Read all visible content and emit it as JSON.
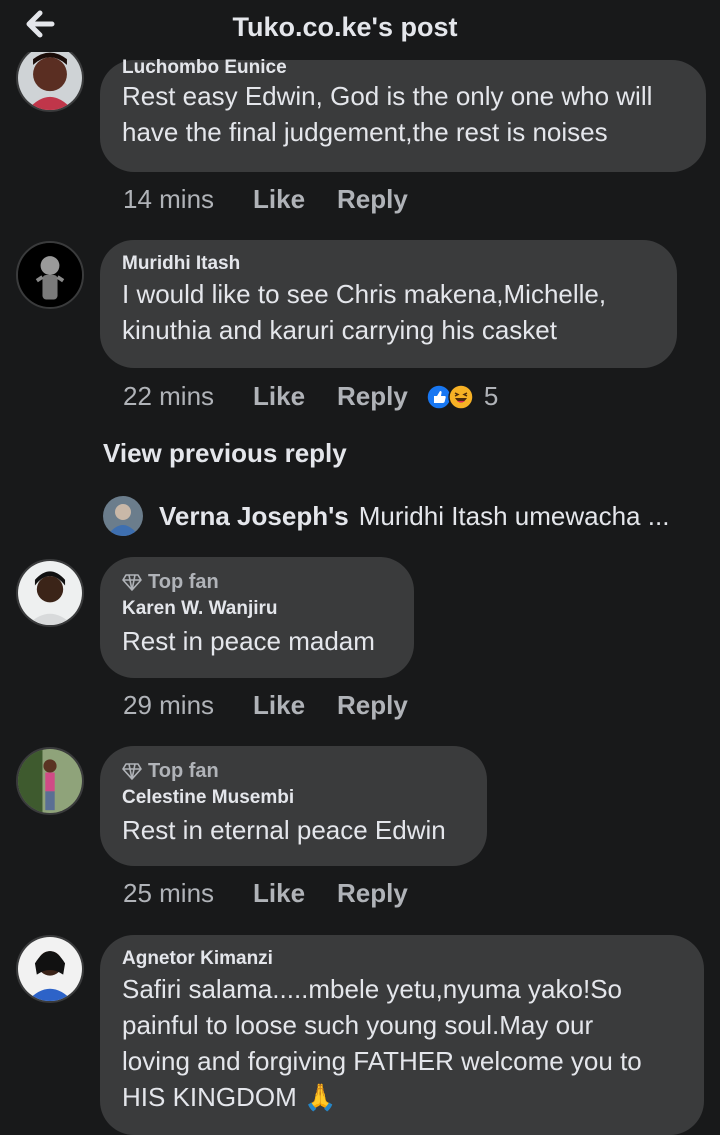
{
  "header": {
    "title": "Tuko.co.ke's post",
    "back_icon": "arrow-left-icon"
  },
  "comments": [
    {
      "author": "Luchombo Eunice",
      "text_lines": [
        "Rest easy Edwin, God is the only one who will",
        "have the final judgement,the rest is  noises"
      ],
      "time": "14 mins",
      "like": "Like",
      "reply": "Reply"
    },
    {
      "author": "Muridhi Itash",
      "text_lines": [
        "I would  like to see Chris  makena,Michelle,",
        "kinuthia and karuri carrying his casket"
      ],
      "time": "22 mins",
      "like": "Like",
      "reply": "Reply",
      "reaction_count": "5"
    },
    {
      "badge": "Top fan",
      "author": "Karen W. Wanjiru",
      "text_lines": [
        "Rest in peace madam"
      ],
      "time": "29 mins",
      "like": "Like",
      "reply": "Reply"
    },
    {
      "badge": "Top fan",
      "author": "Celestine Musembi",
      "text_lines": [
        "Rest in eternal peace Edwin"
      ],
      "time": "25 mins",
      "like": "Like",
      "reply": "Reply"
    },
    {
      "author": "Agnetor Kimanzi",
      "text_lines": [
        "Safiri salama.....mbele yetu,nyuma yako!So",
        "painful to loose such young soul.May our",
        "loving and forgiving FATHER welcome you to",
        "HIS KINGDOM 🙏"
      ]
    }
  ],
  "view_previous": "View previous reply",
  "reply_preview": {
    "name": "Verna Joseph's",
    "text": "Muridhi Itash umewacha ..."
  },
  "colors": {
    "background": "#18191a",
    "bubble": "#3a3b3c",
    "muted": "#b0b3b8",
    "like_blue": "#1877f2",
    "haha_yellow": "#f7b125"
  }
}
